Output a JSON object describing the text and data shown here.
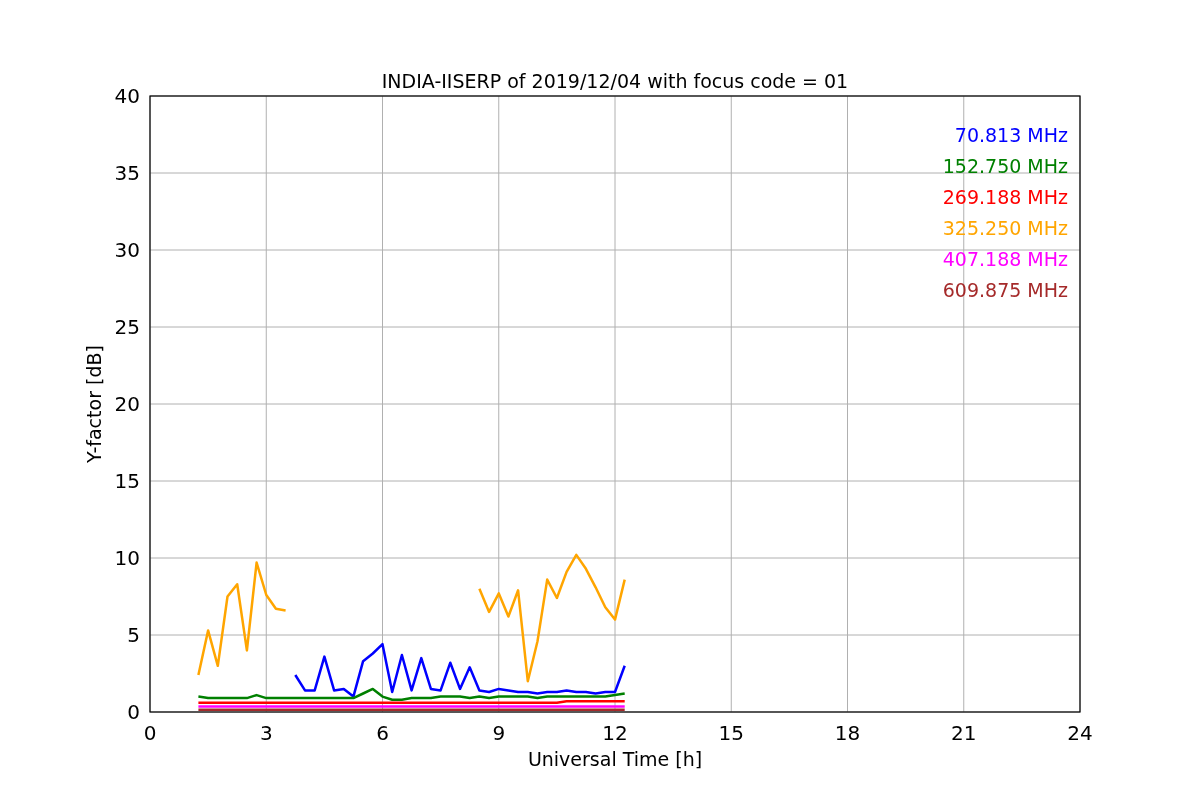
{
  "chart_data": {
    "type": "line",
    "title": "INDIA-IISERP of 2019/12/04 with focus code = 01",
    "xlabel": "Universal Time [h]",
    "ylabel": "Y-factor [dB]",
    "x": [
      1.25,
      1.5,
      1.75,
      2,
      2.25,
      2.5,
      2.75,
      3,
      3.25,
      3.5,
      3.75,
      4,
      4.25,
      4.5,
      4.75,
      5,
      5.25,
      5.5,
      5.75,
      6,
      6.25,
      6.5,
      6.75,
      7,
      7.25,
      7.5,
      7.75,
      8,
      8.25,
      8.5,
      8.75,
      9,
      9.25,
      9.5,
      9.75,
      10,
      10.25,
      10.5,
      10.75,
      11,
      11.25,
      11.5,
      11.75,
      12,
      12.25
    ],
    "series": [
      {
        "name": "70.813 MHz",
        "color": "#0000ff",
        "values": [
          null,
          null,
          null,
          null,
          null,
          null,
          null,
          null,
          null,
          null,
          2.4,
          1.4,
          1.4,
          3.6,
          1.4,
          1.5,
          1.0,
          3.3,
          3.8,
          4.4,
          1.3,
          3.7,
          1.4,
          3.5,
          1.5,
          1.4,
          3.2,
          1.5,
          2.9,
          1.4,
          1.3,
          1.5,
          1.4,
          1.3,
          1.3,
          1.2,
          1.3,
          1.3,
          1.4,
          1.3,
          1.3,
          1.2,
          1.3,
          1.3,
          3.0
        ]
      },
      {
        "name": "152.750 MHz",
        "color": "#008000",
        "values": [
          1.0,
          0.9,
          0.9,
          0.9,
          0.9,
          0.9,
          1.1,
          0.9,
          0.9,
          0.9,
          0.9,
          0.9,
          0.9,
          0.9,
          0.9,
          0.9,
          0.9,
          1.2,
          1.5,
          1.0,
          0.8,
          0.8,
          0.9,
          0.9,
          0.9,
          1.0,
          1.0,
          1.0,
          0.9,
          1.0,
          0.9,
          1.0,
          1.0,
          1.0,
          1.0,
          0.9,
          1.0,
          1.0,
          1.0,
          1.0,
          1.0,
          1.0,
          1.0,
          1.1,
          1.2
        ]
      },
      {
        "name": "269.188 MHz",
        "color": "#ff0000",
        "values": [
          0.6,
          0.6,
          0.6,
          0.6,
          0.6,
          0.6,
          0.6,
          0.6,
          0.6,
          0.6,
          0.6,
          0.6,
          0.6,
          0.6,
          0.6,
          0.6,
          0.6,
          0.6,
          0.6,
          0.6,
          0.6,
          0.6,
          0.6,
          0.6,
          0.6,
          0.6,
          0.6,
          0.6,
          0.6,
          0.6,
          0.6,
          0.6,
          0.6,
          0.6,
          0.6,
          0.6,
          0.6,
          0.6,
          0.7,
          0.7,
          0.7,
          0.7,
          0.7,
          0.7,
          0.7
        ]
      },
      {
        "name": "325.250 MHz",
        "color": "#ffa500",
        "values": [
          2.4,
          5.3,
          3.0,
          7.5,
          8.3,
          4.0,
          9.7,
          7.6,
          6.7,
          6.6,
          null,
          null,
          null,
          null,
          null,
          null,
          null,
          null,
          null,
          null,
          null,
          null,
          null,
          null,
          null,
          null,
          null,
          null,
          null,
          8.0,
          6.5,
          7.7,
          6.2,
          7.9,
          2.0,
          4.6,
          8.6,
          7.4,
          9.1,
          10.2,
          9.3,
          8.1,
          6.8,
          6.0,
          8.6
        ]
      },
      {
        "name": "407.188 MHz",
        "color": "#ff00ff",
        "values": [
          0.35,
          0.35,
          0.35,
          0.35,
          0.35,
          0.35,
          0.35,
          0.35,
          0.35,
          0.35,
          0.35,
          0.35,
          0.35,
          0.35,
          0.35,
          0.35,
          0.35,
          0.35,
          0.35,
          0.35,
          0.35,
          0.35,
          0.35,
          0.35,
          0.35,
          0.35,
          0.35,
          0.35,
          0.35,
          0.35,
          0.35,
          0.35,
          0.35,
          0.35,
          0.35,
          0.35,
          0.35,
          0.35,
          0.35,
          0.35,
          0.35,
          0.35,
          0.35,
          0.35,
          0.35
        ]
      },
      {
        "name": "609.875 MHz",
        "color": "#a52a2a",
        "values": [
          0.15,
          0.15,
          0.15,
          0.15,
          0.15,
          0.15,
          0.15,
          0.15,
          0.15,
          0.15,
          0.15,
          0.15,
          0.15,
          0.15,
          0.15,
          0.15,
          0.15,
          0.15,
          0.15,
          0.15,
          0.15,
          0.15,
          0.15,
          0.15,
          0.15,
          0.15,
          0.15,
          0.15,
          0.15,
          0.15,
          0.15,
          0.15,
          0.15,
          0.15,
          0.15,
          0.15,
          0.15,
          0.15,
          0.15,
          0.15,
          0.15,
          0.15,
          0.15,
          0.15,
          0.15
        ]
      }
    ],
    "grid": true,
    "xlim": [
      0,
      24
    ],
    "ylim": [
      0,
      40
    ],
    "xticks": [
      0,
      3,
      6,
      9,
      12,
      15,
      18,
      21,
      24
    ],
    "yticks": [
      0,
      5,
      10,
      15,
      20,
      25,
      30,
      35,
      40
    ]
  }
}
